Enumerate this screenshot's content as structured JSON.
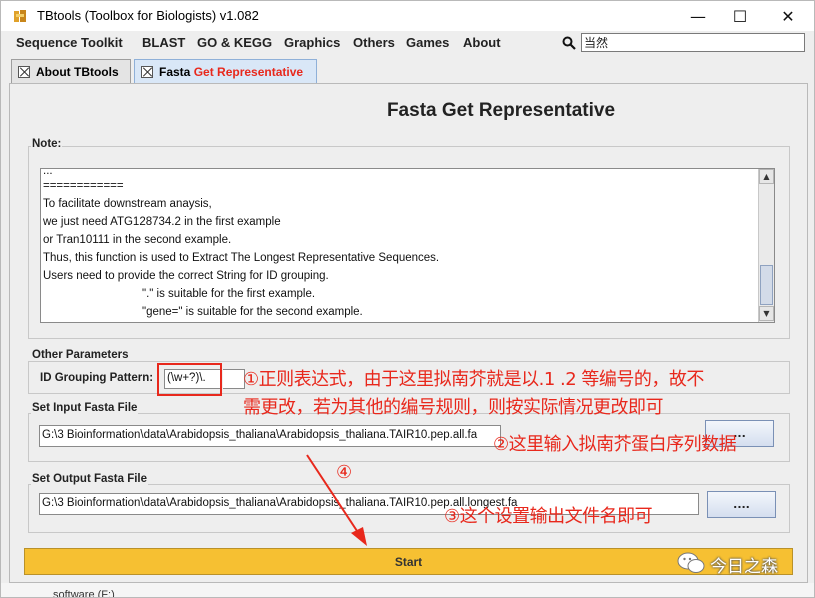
{
  "window": {
    "title": "TBtools (Toolbox for Biologists) v1.082",
    "minimize": "—",
    "maximize": "☐",
    "close": "✕"
  },
  "menubar": {
    "items": [
      "Sequence Toolkit",
      "BLAST",
      "GO & KEGG",
      "Graphics",
      "Others",
      "Games",
      "About"
    ],
    "search_value": "当然"
  },
  "tabs": [
    {
      "label": "About TBtools",
      "active": false
    },
    {
      "label_prefix": "Fasta ",
      "label_highlight": "Get Representative",
      "active": true
    }
  ],
  "panel": {
    "title": "Fasta Get Representative",
    "note": {
      "label": "Note:",
      "lines": [
        "...",
        "============",
        "To facilitate downstream anaysis,",
        "we just need ATG128734.2 in the first example",
        "or Tran10111 in the second example.",
        "Thus, this function is used to Extract The Longest Representative Sequences.",
        "Users need to provide the correct String for ID grouping.",
        "\".\" is suitable for the first example.",
        "\"gene=\" is suitable for the second example."
      ]
    },
    "other_parameters": {
      "label": "Other Parameters",
      "id_label": "ID Grouping Pattern:",
      "id_value": "(\\w+?)\\."
    },
    "input_file": {
      "label": "Set Input Fasta File",
      "value": "G:\\3 Bioinformation\\data\\Arabidopsis_thaliana\\Arabidopsis_thaliana.TAIR10.pep.all.fa",
      "browse": "..."
    },
    "output_file": {
      "label": "Set Output Fasta File",
      "value": "G:\\3 Bioinformation\\data\\Arabidopsis_thaliana\\Arabidopsis_thaliana.TAIR10.pep.all.longest.fa",
      "browse": "...."
    },
    "start": "Start"
  },
  "annotations": {
    "a1_line1": "①正则表达式，由于这里拟南芥就是以.1 .2 等编号的，故不",
    "a1_line2": "需更改，若为其他的编号规则，则按实际情况更改即可",
    "a2": "②这里输入拟南芥蛋白序列数据",
    "a3": "③这个设置输出文件名即可",
    "a4": "④"
  },
  "watermark": "今日之森",
  "bottom": "software (F:)",
  "colors": {
    "accent_red": "#e8281c",
    "start_button": "#f6c032",
    "tab_highlight": "#e8281c"
  }
}
